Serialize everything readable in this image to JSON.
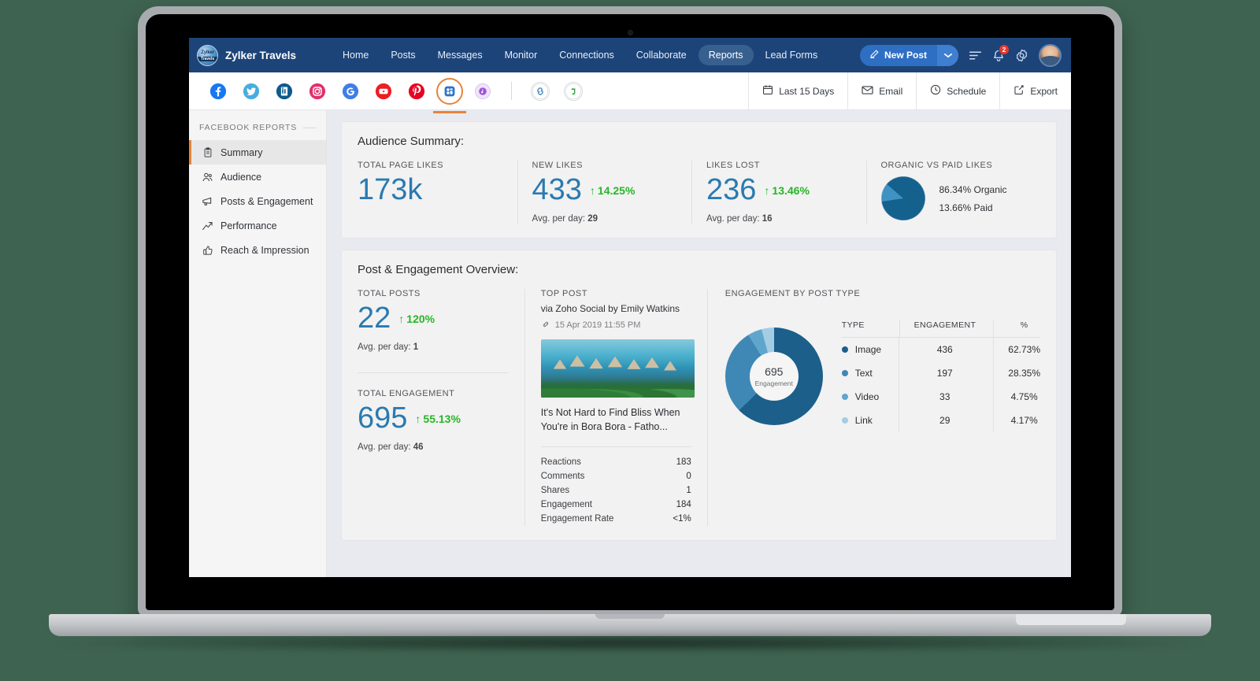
{
  "header": {
    "brand_name": "Zylker Travels",
    "nav": [
      {
        "label": "Home",
        "active": false
      },
      {
        "label": "Posts",
        "active": false
      },
      {
        "label": "Messages",
        "active": false
      },
      {
        "label": "Monitor",
        "active": false
      },
      {
        "label": "Connections",
        "active": false
      },
      {
        "label": "Collaborate",
        "active": false
      },
      {
        "label": "Reports",
        "active": true
      },
      {
        "label": "Lead Forms",
        "active": false
      }
    ],
    "new_post_label": "New Post",
    "notification_count": "2",
    "accent_color": "#1d4478",
    "button_color": "#2e6fc4"
  },
  "channel_bar": {
    "channels": [
      {
        "name": "facebook",
        "color": "#1877f2"
      },
      {
        "name": "twitter",
        "color": "#47acdf"
      },
      {
        "name": "linkedin",
        "color": "#0d5a8e"
      },
      {
        "name": "instagram",
        "color": "#e1306c"
      },
      {
        "name": "google-business",
        "color": "#3f7ee8"
      },
      {
        "name": "youtube",
        "color": "#ed1d24"
      },
      {
        "name": "pinterest",
        "color": "#e60023"
      },
      {
        "name": "facebook-page",
        "color": "#2e74c8"
      },
      {
        "name": "tiktok",
        "color": "#9a54d6"
      },
      {
        "name": "link",
        "color": "#4a87c7"
      },
      {
        "name": "zoho",
        "color": "#37a349"
      }
    ],
    "selected_channel": "facebook-page",
    "selection_color": "#e8833a",
    "actions": [
      {
        "label": "Last 15 Days",
        "icon": "calendar-icon"
      },
      {
        "label": "Email",
        "icon": "envelope-icon"
      },
      {
        "label": "Schedule",
        "icon": "clock-icon"
      },
      {
        "label": "Export",
        "icon": "export-icon"
      }
    ]
  },
  "sidebar": {
    "title": "FACEBOOK REPORTS",
    "items": [
      {
        "label": "Summary",
        "icon": "clipboard-icon",
        "active": true
      },
      {
        "label": "Audience",
        "icon": "people-icon",
        "active": false
      },
      {
        "label": "Posts & Engagement",
        "icon": "megaphone-icon",
        "active": false
      },
      {
        "label": "Performance",
        "icon": "trend-icon",
        "active": false
      },
      {
        "label": "Reach & Impression",
        "icon": "thumbsup-icon",
        "active": false
      }
    ]
  },
  "audience_summary": {
    "title": "Audience Summary:",
    "metrics": [
      {
        "label": "TOTAL PAGE LIKES",
        "value": "173k",
        "delta": "",
        "sub": "",
        "sub_value": ""
      },
      {
        "label": "NEW LIKES",
        "value": "433",
        "delta": "14.25%",
        "sub": "Avg. per day:",
        "sub_value": "29"
      },
      {
        "label": "LIKES LOST",
        "value": "236",
        "delta": "13.46%",
        "sub": "Avg. per day:",
        "sub_value": "16"
      }
    ],
    "pie_label": "ORGANIC VS PAID LIKES",
    "pie_legend": [
      "86.34% Organic",
      "13.66% Paid"
    ]
  },
  "post_engagement": {
    "title": "Post & Engagement Overview:",
    "total_posts": {
      "label": "TOTAL POSTS",
      "value": "22",
      "delta": "120%",
      "sub": "Avg. per day:",
      "sub_value": "1"
    },
    "total_engagement": {
      "label": "TOTAL ENGAGEMENT",
      "value": "695",
      "delta": "55.13%",
      "sub": "Avg. per day:",
      "sub_value": "46"
    },
    "top_post": {
      "label": "TOP POST",
      "via": "via Zoho Social by Emily Watkins",
      "date": "15 Apr 2019 11:55 PM",
      "title": "It's Not Hard to Find Bliss When You're in Bora Bora - Fatho...",
      "stats": [
        {
          "label": "Reactions",
          "value": "183"
        },
        {
          "label": "Comments",
          "value": "0"
        },
        {
          "label": "Shares",
          "value": "1"
        },
        {
          "label": "Engagement",
          "value": "184"
        },
        {
          "label": "Engagement Rate",
          "value": "<1%"
        }
      ]
    },
    "engagement_chart_label": "ENGAGEMENT BY POST TYPE"
  },
  "chart_data": [
    {
      "type": "pie",
      "title": "ORGANIC VS PAID LIKES",
      "categories": [
        "Organic",
        "Paid"
      ],
      "values": [
        86.34,
        13.66
      ],
      "colors": [
        "#15618e",
        "#3f93c2"
      ],
      "unit": "%",
      "legend": "right"
    },
    {
      "type": "pie",
      "subtype": "donut",
      "title": "ENGAGEMENT BY POST TYPE",
      "center_value": "695",
      "center_label": "Engagement",
      "columns": [
        "TYPE",
        "ENGAGEMENT",
        "%"
      ],
      "categories": [
        "Image",
        "Text",
        "Video",
        "Link"
      ],
      "values": [
        436,
        197,
        33,
        29
      ],
      "percents": [
        "62.73%",
        "28.35%",
        "4.75%",
        "4.17%"
      ],
      "colors": [
        "#1c5f8a",
        "#3f88b6",
        "#5fa6cd",
        "#a3cde4"
      ],
      "legend": "right"
    }
  ]
}
